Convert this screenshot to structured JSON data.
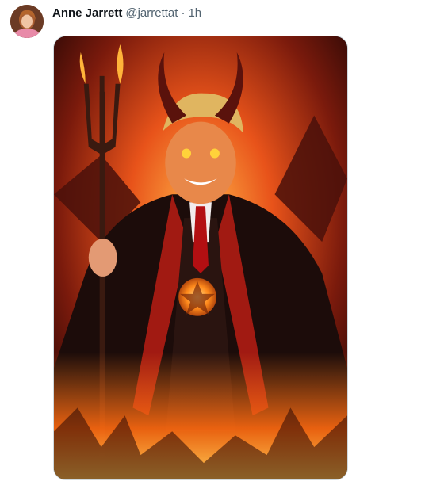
{
  "tweet": {
    "author_name": "Anne Jarrett",
    "author_handle": "@jarrettat",
    "separator": "·",
    "timestamp": "1h"
  },
  "media": {
    "icon": "image-icon"
  },
  "colors": {
    "name": "#0f1419",
    "secondary": "#536471",
    "border": "#cfd9de"
  }
}
